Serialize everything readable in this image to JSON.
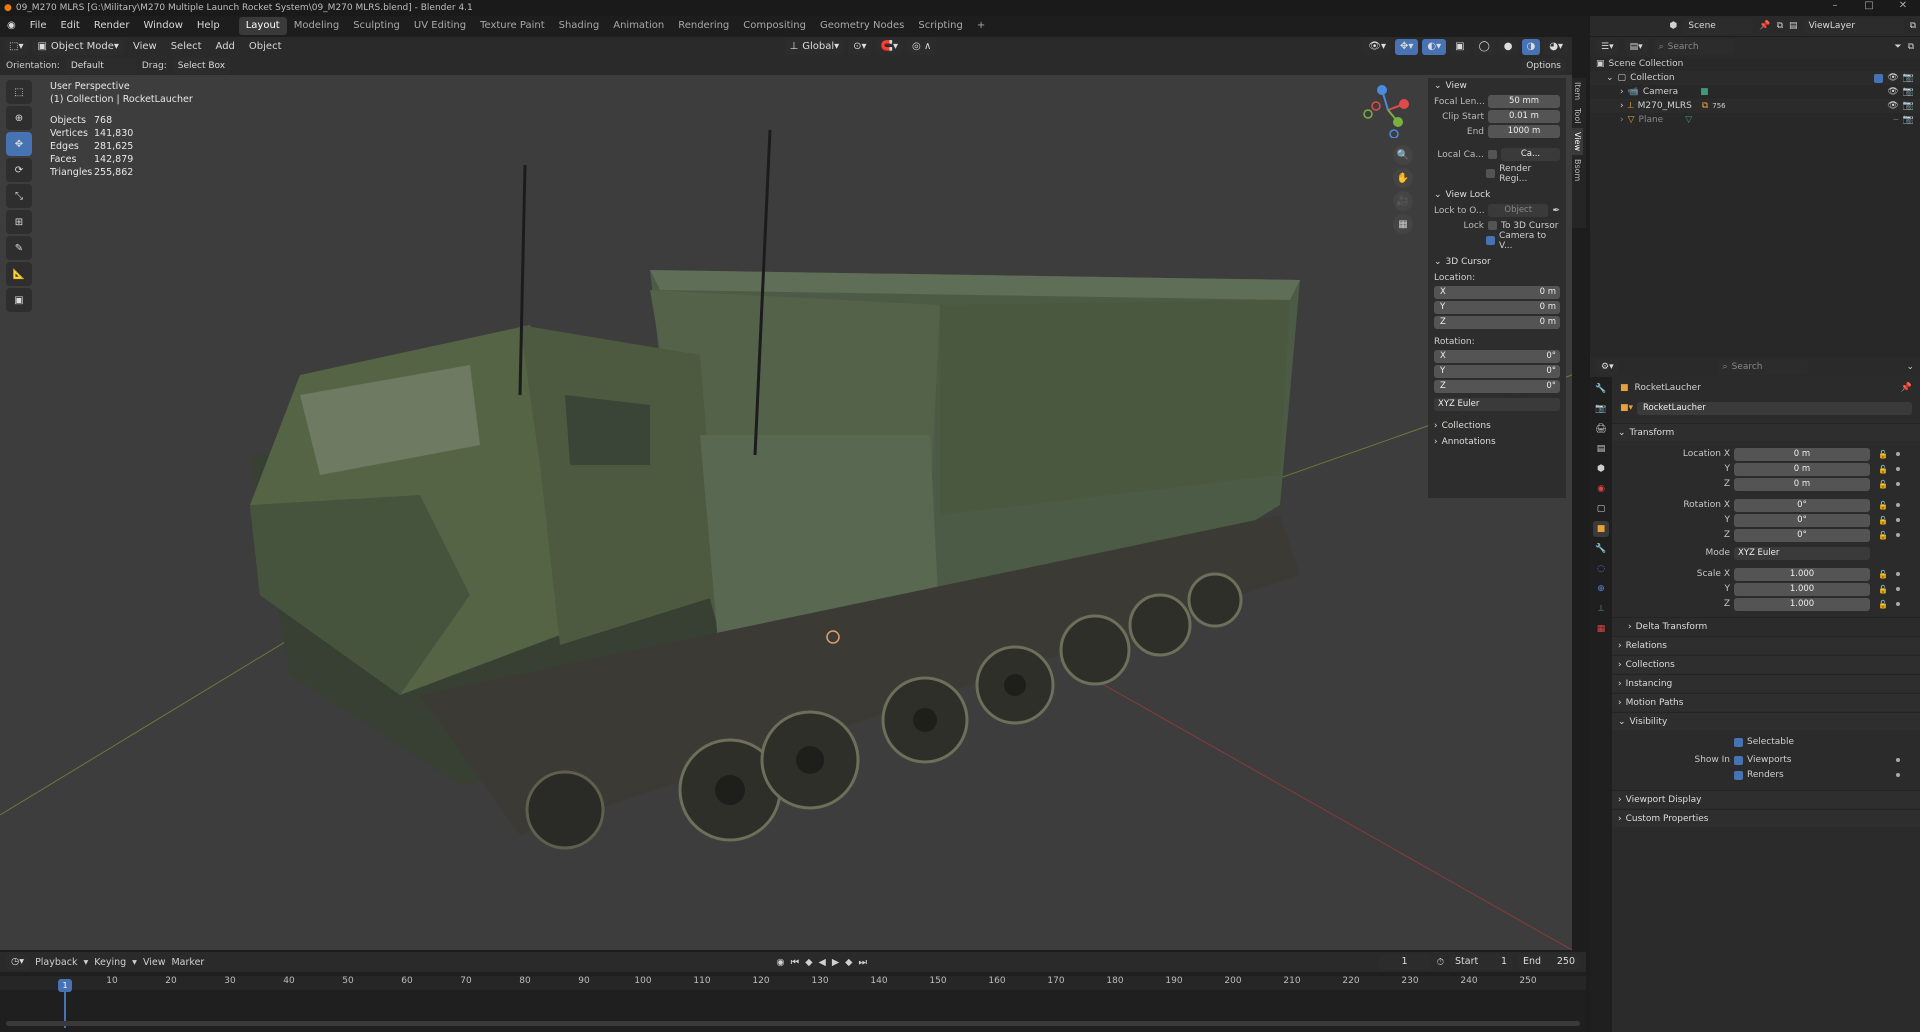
{
  "window": {
    "title": "09_M270 MLRS [G:\\Military\\M270 Multiple Launch Rocket System\\09_M270 MLRS.blend] - Blender 4.1"
  },
  "menu": {
    "items": [
      "File",
      "Edit",
      "Render",
      "Window",
      "Help"
    ]
  },
  "workspaces": {
    "tabs": [
      "Layout",
      "Modeling",
      "Sculpting",
      "UV Editing",
      "Texture Paint",
      "Shading",
      "Animation",
      "Rendering",
      "Compositing",
      "Geometry Nodes",
      "Scripting"
    ],
    "add": "+"
  },
  "topright": {
    "scene": "Scene",
    "viewlayer": "ViewLayer"
  },
  "viewport_header": {
    "mode": "Object Mode",
    "menus": [
      "View",
      "Select",
      "Add",
      "Object"
    ],
    "transform": "Global",
    "options": "Options"
  },
  "tool_settings": {
    "orientation_label": "Orientation:",
    "orientation_value": "Default",
    "drag_label": "Drag:",
    "drag_value": "Select Box"
  },
  "overlay": {
    "perspective": "User Perspective",
    "collection": "(1) Collection | RocketLaucher"
  },
  "stats": [
    {
      "label": "Objects",
      "value": "768"
    },
    {
      "label": "Vertices",
      "value": "141,830"
    },
    {
      "label": "Edges",
      "value": "281,625"
    },
    {
      "label": "Faces",
      "value": "142,879"
    },
    {
      "label": "Triangles",
      "value": "255,862"
    }
  ],
  "npanel": {
    "tabs": [
      "Item",
      "Tool",
      "View",
      "Bsom"
    ],
    "view_title": "View",
    "focal_label": "Focal Len...",
    "focal_value": "50 mm",
    "clip_start_label": "Clip Start",
    "clip_start_value": "0.01 m",
    "clip_end_label": "End",
    "clip_end_value": "1000 m",
    "local_cam_label": "Local Ca...",
    "local_cam_value": "Ca...",
    "render_region": "Render Regi...",
    "view_lock_title": "View Lock",
    "lock_obj_label": "Lock to O...",
    "lock_obj_placeholder": "Object",
    "lock_label": "Lock",
    "to_cursor": "To 3D Cursor",
    "cam_to_view": "Camera to V...",
    "cursor_title": "3D Cursor",
    "location_label": "Location:",
    "loc": [
      {
        "axis": "X",
        "value": "0 m"
      },
      {
        "axis": "Y",
        "value": "0 m"
      },
      {
        "axis": "Z",
        "value": "0 m"
      }
    ],
    "rotation_label": "Rotation:",
    "rot": [
      {
        "axis": "X",
        "value": "0°"
      },
      {
        "axis": "Y",
        "value": "0°"
      },
      {
        "axis": "Z",
        "value": "0°"
      }
    ],
    "rot_mode": "XYZ Euler",
    "collections": "Collections",
    "annotations": "Annotations"
  },
  "outliner": {
    "search_placeholder": "Search",
    "items": [
      {
        "label": "Scene Collection",
        "indent": 0
      },
      {
        "label": "Collection",
        "indent": 1
      },
      {
        "label": "Camera",
        "indent": 2
      },
      {
        "label": "M270_MLRS",
        "indent": 2,
        "badge": "756"
      },
      {
        "label": "Plane",
        "indent": 2
      }
    ]
  },
  "properties": {
    "search_placeholder": "Search",
    "object_name": "RocketLaucher",
    "object_field": "RocketLaucher",
    "transform_title": "Transform",
    "location": [
      {
        "label": "Location X",
        "value": "0 m"
      },
      {
        "label": "Y",
        "value": "0 m"
      },
      {
        "label": "Z",
        "value": "0 m"
      }
    ],
    "rotation": [
      {
        "label": "Rotation X",
        "value": "0°"
      },
      {
        "label": "Y",
        "value": "0°"
      },
      {
        "label": "Z",
        "value": "0°"
      }
    ],
    "mode_label": "Mode",
    "mode_value": "XYZ Euler",
    "scale": [
      {
        "label": "Scale X",
        "value": "1.000"
      },
      {
        "label": "Y",
        "value": "1.000"
      },
      {
        "label": "Z",
        "value": "1.000"
      }
    ],
    "delta": "Delta Transform",
    "sections": [
      "Relations",
      "Collections",
      "Instancing",
      "Motion Paths"
    ],
    "visibility_title": "Visibility",
    "selectable": "Selectable",
    "show_in_label": "Show In",
    "viewports": "Viewports",
    "renders": "Renders",
    "sections2": [
      "Viewport Display",
      "Custom Properties"
    ]
  },
  "timeline": {
    "menus": [
      "Playback",
      "Keying",
      "View",
      "Marker"
    ],
    "current_frame": "1",
    "start_label": "Start",
    "start_value": "1",
    "end_label": "End",
    "end_value": "250",
    "ticks": [
      "10",
      "20",
      "30",
      "40",
      "50",
      "60",
      "70",
      "80",
      "90",
      "100",
      "110",
      "120",
      "130",
      "140",
      "150",
      "160",
      "170",
      "180",
      "190",
      "200",
      "210",
      "220",
      "230",
      "240",
      "250"
    ],
    "playhead": "1"
  },
  "colors": {
    "accent": "#4772b3",
    "viewport_bg": "#3d3d3d",
    "vehicle": "#4d5a44",
    "axis_red": "#8a3a3a",
    "axis_green": "#6a7a3a"
  }
}
